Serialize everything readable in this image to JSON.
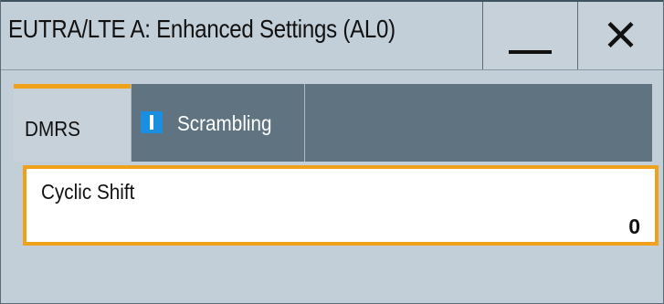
{
  "window": {
    "title": "EUTRA/LTE A: Enhanced Settings (AL0)",
    "buttons": {
      "minimize_icon": "minus-icon",
      "close_icon": "close-icon"
    }
  },
  "tabs": [
    {
      "label": "DMRS",
      "active": true
    },
    {
      "label": "Scrambling",
      "active": false,
      "icon": "info-indicator-icon"
    }
  ],
  "settings": {
    "cyclic_shift": {
      "label": "Cyclic Shift",
      "value": "0"
    }
  },
  "colors": {
    "accent": "#f0a11a",
    "tab_strip": "#5f7381",
    "panel": "#c2ced8",
    "info_blue": "#1a8fe0"
  }
}
